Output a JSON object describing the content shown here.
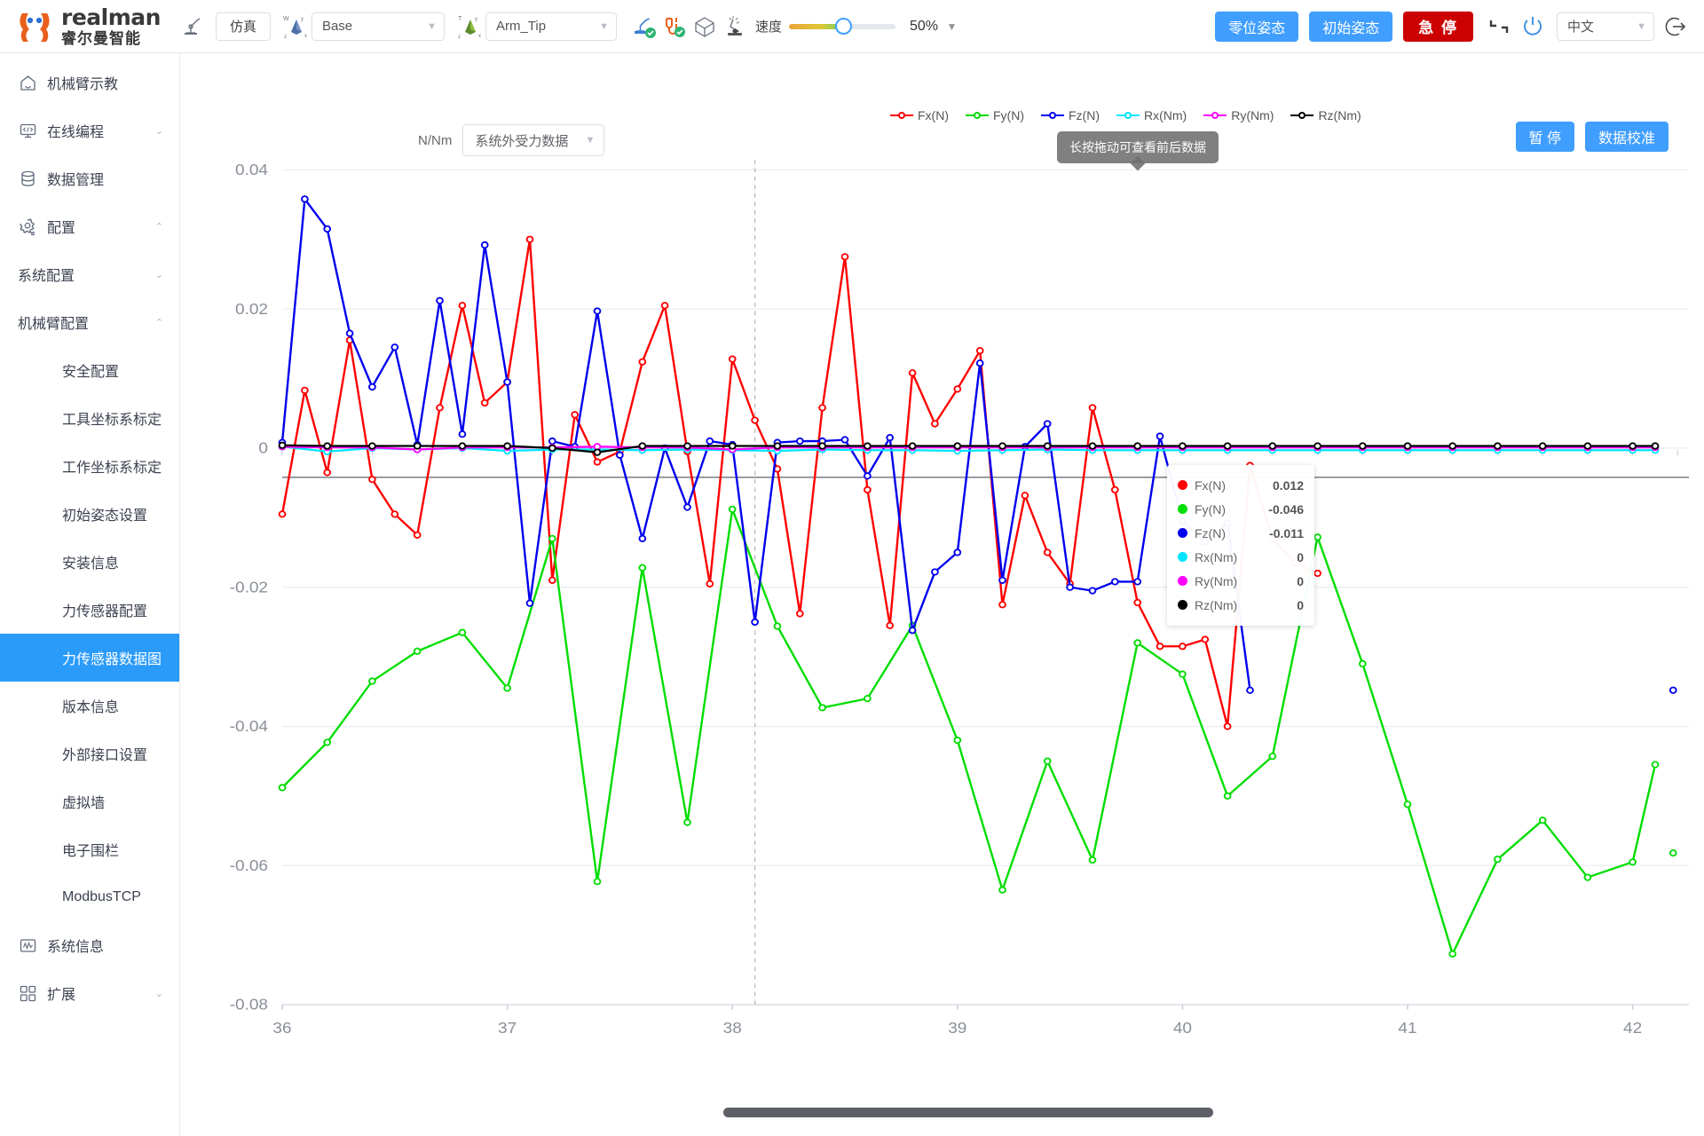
{
  "brand": {
    "en": "realman",
    "cn": "睿尔曼智能",
    "logo_icon": "realman-logo-icon"
  },
  "header": {
    "teach_icon": "robot-arm-teach-icon",
    "sim_button": "仿真",
    "world_frame_icon": "world-frame-icon",
    "world_frame_value": "Base",
    "tool_frame_icon": "tool-frame-icon",
    "tool_frame_value": "Arm_Tip",
    "status_icons": [
      "robot-connected-icon",
      "cable-connected-icon",
      "cube-icon",
      "collision-icon"
    ],
    "speed_label": "速度",
    "speed_value": "50%",
    "zero_pose_button": "零位姿态",
    "init_pose_button": "初始姿态",
    "estop_button": "急 停",
    "estop_color": "#cc0000",
    "drag_icon": "drag-teach-icon",
    "power_icon": "power-icon",
    "language_value": "中文",
    "logout_icon": "logout-icon",
    "accent_color": "#409eff"
  },
  "sidebar": {
    "items": [
      {
        "label": "机械臂示教",
        "icon": "home-icon",
        "type": "item",
        "arrow": ""
      },
      {
        "label": "在线编程",
        "icon": "code-monitor-icon",
        "type": "item",
        "arrow": "⌄"
      },
      {
        "label": "数据管理",
        "icon": "database-icon",
        "type": "item",
        "arrow": ""
      },
      {
        "label": "配置",
        "icon": "gear-icon",
        "type": "item",
        "arrow": "⌃"
      },
      {
        "label": "系统配置",
        "type": "sub",
        "arrow": "⌄"
      },
      {
        "label": "机械臂配置",
        "type": "sub",
        "arrow": "⌃"
      },
      {
        "label": "安全配置",
        "type": "leaf"
      },
      {
        "label": "工具坐标系标定",
        "type": "leaf"
      },
      {
        "label": "工作坐标系标定",
        "type": "leaf"
      },
      {
        "label": "初始姿态设置",
        "type": "leaf"
      },
      {
        "label": "安装信息",
        "type": "leaf"
      },
      {
        "label": "力传感器配置",
        "type": "leaf"
      },
      {
        "label": "力传感器数据图",
        "type": "leaf",
        "active": true
      },
      {
        "label": "版本信息",
        "type": "leaf"
      },
      {
        "label": "外部接口设置",
        "type": "leaf"
      },
      {
        "label": "虚拟墙",
        "type": "leaf"
      },
      {
        "label": "电子围栏",
        "type": "leaf"
      },
      {
        "label": "ModbusTCP",
        "type": "leaf"
      },
      {
        "label": "系统信息",
        "icon": "waveform-icon",
        "type": "item",
        "arrow": ""
      },
      {
        "label": "扩展",
        "icon": "grid-icon",
        "type": "item",
        "arrow": "⌄"
      }
    ],
    "active_color": "#2b9bfa"
  },
  "main": {
    "unit_label": "N/Nm",
    "source_select": "系统外受力数据",
    "hint_tooltip": "长按拖动可查看前后数据",
    "pause_button": "暂 停",
    "calibrate_button": "数据校准",
    "scrollbar_name": "horizontal-scrollbar"
  },
  "tooltip": {
    "rows": [
      {
        "name": "Fx(N)",
        "value": "0.012",
        "color": "#ff0000"
      },
      {
        "name": "Fy(N)",
        "value": "-0.046",
        "color": "#00dd00"
      },
      {
        "name": "Fz(N)",
        "value": "-0.011",
        "color": "#0000ee"
      },
      {
        "name": "Rx(Nm)",
        "value": "0",
        "color": "#00e5ff"
      },
      {
        "name": "Ry(Nm)",
        "value": "0",
        "color": "#ff00ff"
      },
      {
        "name": "Rz(Nm)",
        "value": "0",
        "color": "#000000"
      }
    ]
  },
  "chart_data": {
    "type": "line",
    "title": "",
    "xlabel": "",
    "ylabel": "N/Nm",
    "ylim": [
      -0.08,
      0.04
    ],
    "xlim": [
      36,
      42.25
    ],
    "yticks": [
      "0.04",
      "0.02",
      "0",
      "-0.02",
      "-0.04",
      "-0.06",
      "-0.08"
    ],
    "ytickvals": [
      0.04,
      0.02,
      0,
      -0.02,
      -0.04,
      -0.06,
      -0.08
    ],
    "xticks": [
      "36",
      "37",
      "38",
      "39",
      "40",
      "41",
      "42"
    ],
    "xtickvals": [
      36,
      37,
      38,
      39,
      40,
      41,
      42
    ],
    "grid": true,
    "legend_position": "top",
    "marker_cursor_x": 38.1,
    "series": [
      {
        "name": "Fx(N)",
        "color": "#ff0000",
        "x": [
          36.0,
          36.1,
          36.2,
          36.3,
          36.4,
          36.5,
          36.6,
          36.7,
          36.8,
          36.9,
          37.0,
          37.1,
          37.2,
          37.3,
          37.4,
          37.5,
          37.6,
          37.7,
          37.8,
          37.9,
          38.0,
          38.1,
          38.2,
          38.3,
          38.4,
          38.5,
          38.6,
          38.7,
          38.8,
          38.9,
          39.0,
          39.1,
          39.2,
          39.3,
          39.4,
          39.5,
          39.6,
          39.7,
          39.8,
          39.9,
          40.0,
          40.1,
          40.2,
          40.3,
          40.4,
          40.5,
          40.6,
          40.7,
          40.8,
          40.9,
          41.0,
          41.1,
          41.2,
          41.3,
          41.4,
          41.5,
          41.6,
          41.7,
          41.8,
          41.9,
          42.0,
          42.1
        ],
        "values": [
          -0.0095,
          0.0083,
          -0.0035,
          0.0155,
          -0.0045,
          -0.0095,
          -0.0125,
          0.0058,
          0.0205,
          0.0065,
          0.0095,
          0.03,
          -0.019,
          0.0048,
          -0.002,
          -0.0005,
          0.0124,
          0.0205,
          -0.0005,
          -0.0195,
          0.0128,
          0.004,
          -0.003,
          -0.0238,
          0.0058,
          0.0275,
          -0.006,
          -0.0255,
          0.0108,
          0.0035,
          0.0085,
          0.014,
          -0.0225,
          -0.0068,
          -0.015,
          -0.0195,
          0.0058,
          -0.006,
          -0.0222,
          -0.0285,
          -0.0285,
          -0.0275,
          -0.04,
          -0.0025,
          -0.013,
          -0.0165,
          -0.018
        ]
      },
      {
        "name": "Fy(N)",
        "color": "#00dd00",
        "x": [
          36.0,
          36.2,
          36.4,
          36.6,
          36.8,
          37.0,
          37.2,
          37.4,
          37.6,
          37.8,
          38.0,
          38.2,
          38.4,
          38.6,
          38.8,
          39.0,
          39.2,
          39.4,
          39.6,
          39.8,
          40.0,
          40.2,
          40.4,
          40.6,
          40.8,
          41.0,
          41.2,
          41.4,
          41.6,
          41.8,
          42.0,
          42.1
        ],
        "values": [
          -0.0488,
          -0.0423,
          -0.0335,
          -0.0292,
          -0.0265,
          -0.0345,
          -0.013,
          -0.0623,
          -0.0172,
          -0.0538,
          -0.0088,
          -0.0256,
          -0.0373,
          -0.036,
          -0.0255,
          -0.042,
          -0.0635,
          -0.045,
          -0.0592,
          -0.028,
          -0.0325,
          -0.05,
          -0.0443,
          -0.0128,
          -0.031,
          -0.0512,
          -0.0727,
          -0.0591,
          -0.0535,
          -0.0617,
          -0.0595,
          -0.0455,
          -0.0582
        ]
      },
      {
        "name": "Fz(N)",
        "color": "#0000ee",
        "x": [
          36.0,
          36.1,
          36.2,
          36.3,
          36.4,
          36.5,
          36.6,
          36.7,
          36.8,
          36.9,
          37.0,
          37.1,
          37.2,
          37.3,
          37.4,
          37.5,
          37.6,
          37.7,
          37.8,
          37.9,
          38.0,
          38.1,
          38.2,
          38.3,
          38.4,
          38.5,
          38.6,
          38.7,
          38.8,
          38.9,
          39.0,
          39.1,
          39.2,
          39.3,
          39.4,
          39.5,
          39.6,
          39.7,
          39.8,
          39.9,
          40.0,
          40.1,
          40.2,
          40.3,
          40.4,
          40.5,
          40.6,
          40.7,
          42.1
        ],
        "values": [
          0.0008,
          0.0358,
          0.0315,
          0.0165,
          0.0088,
          0.0145,
          0.0005,
          0.0212,
          0.002,
          0.0292,
          0.0095,
          -0.0223,
          0.001,
          0.0002,
          0.0197,
          -0.001,
          -0.013,
          0.0,
          -0.0085,
          0.001,
          0.0005,
          -0.025,
          0.0008,
          0.001,
          0.001,
          0.0012,
          -0.004,
          0.0015,
          -0.0262,
          -0.0178,
          -0.015,
          0.0122,
          -0.019,
          0.0002,
          0.0035,
          -0.02,
          -0.0205,
          -0.0192,
          -0.0192,
          0.0017,
          -0.0105,
          -0.0135,
          -0.0108,
          -0.0348
        ]
      },
      {
        "name": "Rx(Nm)",
        "color": "#00e5ff",
        "x": [
          36.0,
          36.2,
          36.4,
          36.6,
          36.8,
          37.0,
          37.2,
          37.4,
          37.6,
          37.8,
          38.0,
          38.2,
          38.4,
          38.6,
          38.8,
          39.0,
          39.2,
          39.4,
          39.6,
          39.8,
          40.0,
          40.2,
          40.4,
          40.6,
          40.8,
          41.0,
          41.2,
          41.4,
          41.6,
          41.8,
          42.0,
          42.1
        ],
        "values": [
          0.0002,
          -0.0005,
          0.0,
          -0.0002,
          0.0,
          -0.0004,
          -0.0002,
          -0.0002,
          -0.0003,
          -0.0002,
          -0.0003,
          -0.0004,
          -0.0002,
          -0.0003,
          -0.0003,
          -0.0004,
          -0.0003,
          -0.0002,
          -0.0003,
          -0.0003,
          -0.0003,
          -0.0003,
          -0.0003,
          -0.0003,
          -0.0003,
          -0.0003,
          -0.0003,
          -0.0003,
          -0.0003,
          -0.0003,
          -0.0003,
          -0.0003
        ]
      },
      {
        "name": "Ry(Nm)",
        "color": "#ff00ff",
        "x": [
          36.0,
          36.2,
          36.4,
          36.6,
          36.8,
          37.0,
          37.2,
          37.4,
          37.6,
          37.8,
          38.0,
          38.2,
          38.4,
          38.6,
          38.8,
          39.0,
          39.2,
          39.4,
          39.6,
          39.8,
          40.0,
          40.2,
          40.4,
          40.6,
          40.8,
          41.0,
          41.2,
          41.4,
          41.6,
          41.8,
          42.0,
          42.1
        ],
        "values": [
          0.0002,
          0.0001,
          0.0001,
          -0.0002,
          0.0001,
          0.0001,
          0.0001,
          0.0002,
          0.0001,
          0.0001,
          -0.0002,
          0.0001,
          0.0001,
          0.0001,
          0.0001,
          0.0001,
          0.0001,
          0.0001,
          0.0001,
          0.0001,
          0.0001,
          0.0001,
          0.0001,
          0.0001,
          0.0001,
          0.0001,
          0.0001,
          0.0001,
          0.0001,
          0.0001,
          0.0001,
          0.0001
        ]
      },
      {
        "name": "Rz(Nm)",
        "color": "#000000",
        "x": [
          36.0,
          36.2,
          36.4,
          36.6,
          36.8,
          37.0,
          37.2,
          37.4,
          37.6,
          37.8,
          38.0,
          38.2,
          38.4,
          38.6,
          38.8,
          39.0,
          39.2,
          39.4,
          39.6,
          39.8,
          40.0,
          40.2,
          40.4,
          40.6,
          40.8,
          41.0,
          41.2,
          41.4,
          41.6,
          41.8,
          42.0,
          42.1
        ],
        "values": [
          0.0004,
          0.0003,
          0.0003,
          0.0003,
          0.0003,
          0.0003,
          0.0,
          -0.0006,
          0.0003,
          0.0003,
          0.0003,
          0.0003,
          0.0003,
          0.0003,
          0.0003,
          0.0003,
          0.0003,
          0.0003,
          0.0003,
          0.0003,
          0.0003,
          0.0003,
          0.0003,
          0.0003,
          0.0003,
          0.0003,
          0.0003,
          0.0003,
          0.0003,
          0.0003,
          0.0003,
          0.0003
        ]
      }
    ]
  }
}
